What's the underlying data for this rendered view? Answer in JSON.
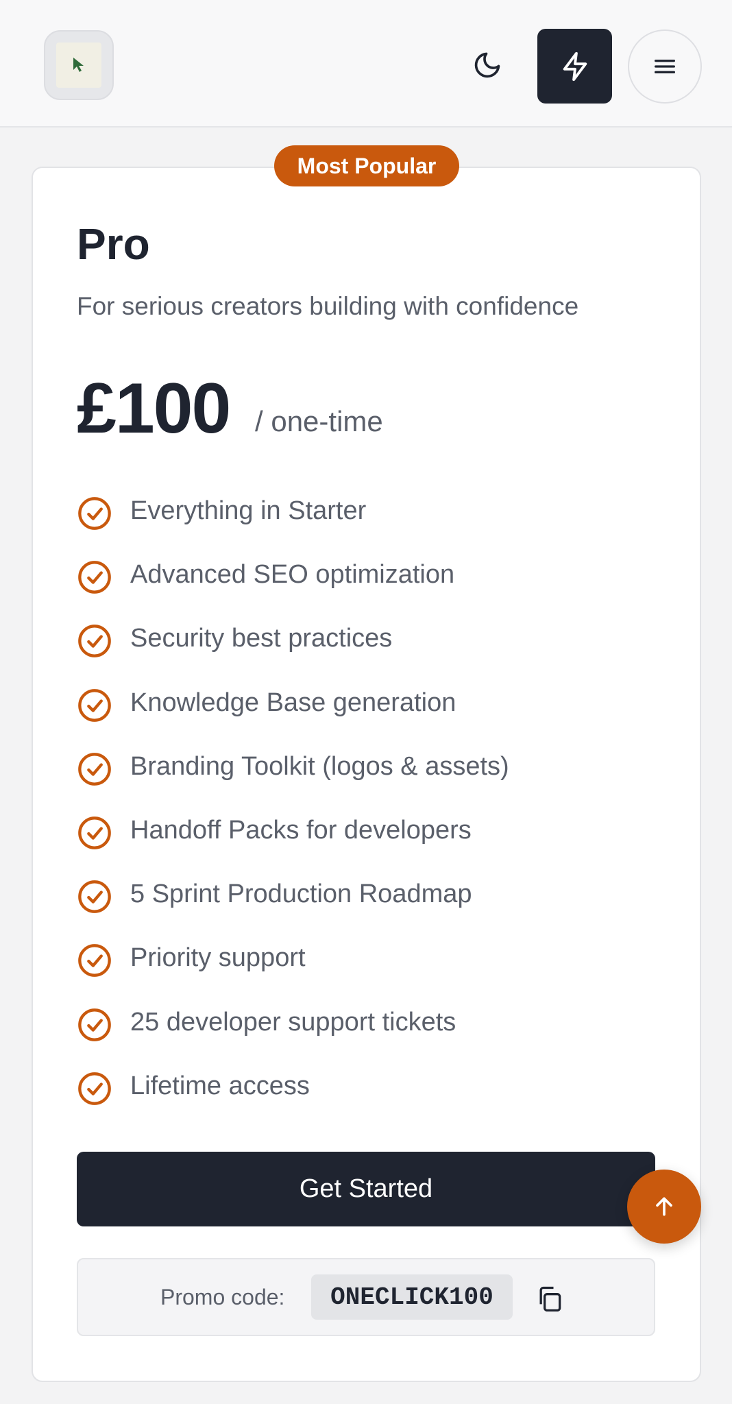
{
  "header": {
    "logo_alt": "logo",
    "theme_icon": "moon-icon",
    "action_icon": "bolt-icon",
    "menu_icon": "menu-icon"
  },
  "card": {
    "badge": "Most Popular",
    "title": "Pro",
    "description": "For serious creators building with confidence",
    "price": "£100",
    "price_period": "/ one-time",
    "features": [
      "Everything in Starter",
      "Advanced SEO optimization",
      "Security best practices",
      "Knowledge Base generation",
      "Branding Toolkit (logos & assets)",
      "Handoff Packs for developers",
      "5 Sprint Production Roadmap",
      "Priority support",
      "25 developer support tickets",
      "Lifetime access"
    ],
    "cta_label": "Get Started",
    "promo_label": "Promo code:",
    "promo_code": "ONECLICK100"
  },
  "colors": {
    "accent": "#c9590d",
    "dark": "#1f2430",
    "muted_text": "#5a5f6a"
  }
}
